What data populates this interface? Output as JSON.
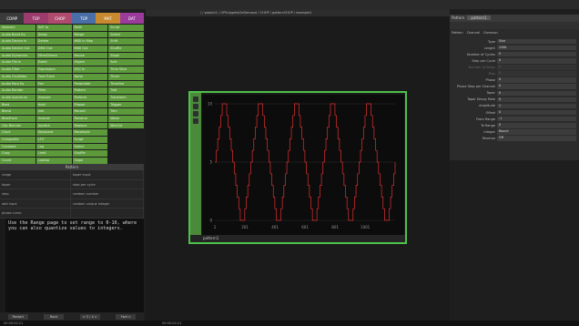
{
  "path": {
    "text": "/ / project1 / OPSnippetsOnDemand / CHOP / patternCHOP / example1"
  },
  "tabs": [
    {
      "label": "COMP",
      "color": "#3a3a3a"
    },
    {
      "label": "TOP",
      "color": "#9b3b6e"
    },
    {
      "label": "CHOP",
      "color": "#b04b6e"
    },
    {
      "label": "TOP",
      "color": "#4a6fa8"
    },
    {
      "label": "MAT",
      "color": "#c98a2f"
    },
    {
      "label": "DAT",
      "color": "#9b3b9b"
    }
  ],
  "operators": [
    "Abstract",
    "DAT to",
    "Math",
    "Script",
    "Audio Band Eq",
    "Delay",
    "Merge",
    "Select",
    "Audio Device In",
    "Delete",
    "MIDI In Map",
    "Shift",
    "Audio Device Out",
    "DMX Out",
    "MIDI Out",
    "Shuffle",
    "Audio Dynamics",
    "EtherDream",
    "Mouse",
    "Slope",
    "Audio File In",
    "Event",
    "Object",
    "Sort",
    "Audio Filter",
    "Expression",
    "OSC In",
    "Time Slice",
    "Audio Oscillator",
    "Face Track",
    "Noise",
    "Timer",
    "Audio Para Eq",
    "Fan",
    "Parameter",
    "Timeline",
    "Audio Render",
    "Filter",
    "Pattern",
    "Trail",
    "Audio Spectrum",
    "Gesture",
    "Perform",
    "Transform",
    "Beat",
    "Hold",
    "Phaser",
    "Trigger",
    "Blend",
    "Info",
    "Record",
    "Trim",
    "BlobTrack",
    "Inverse",
    "Rename",
    "Wave",
    "Clip Blender",
    "Joystick",
    "Replace",
    "WrnOut",
    "Clock",
    "Keyboard",
    "Resample",
    "",
    "Composite",
    "LFO",
    "Script",
    "",
    "Constant",
    "Lag",
    "Select",
    "",
    "Copy",
    "Limit",
    "Shuffle",
    "",
    "Count",
    "Lookup",
    "Slope",
    ""
  ],
  "info": {
    "title": "Pattern",
    "rows": [
      "range",
      "taper input",
      "taper",
      "step per cycle",
      "step",
      "random number",
      "add input",
      "random unique integer",
      "phase curve",
      ""
    ]
  },
  "textbox": {
    "content": "Use the Range page to set range to 0-10, where you can also quantize values to integers."
  },
  "nav": {
    "first": "Restart",
    "prev": "Back",
    "next": "< 3 / 4 >",
    "last": "Fwd >"
  },
  "bottom": {
    "left_time": "00:00:02:21",
    "right_time": "00:00:02:21"
  },
  "node": {
    "name": "pattern1"
  },
  "chart_data": {
    "type": "line",
    "x": [
      1,
      10,
      20,
      30,
      40,
      50,
      60,
      70,
      80,
      90,
      100,
      110,
      120,
      130,
      140,
      150,
      160,
      170,
      180,
      190,
      200,
      210,
      220,
      230,
      240,
      250,
      260,
      270,
      280,
      290,
      300,
      310,
      320,
      330,
      340,
      350,
      360,
      370,
      380,
      390,
      400,
      410,
      420,
      430,
      440,
      450,
      460,
      470,
      480,
      490,
      500,
      510,
      520,
      530,
      540,
      550,
      560,
      570,
      580,
      590,
      600,
      610,
      620,
      630,
      640,
      650,
      660,
      670,
      680,
      690,
      700,
      710,
      720,
      730,
      740,
      750,
      760,
      770,
      780,
      790,
      800,
      810,
      820,
      830,
      840,
      850,
      860,
      870,
      880,
      890,
      900,
      910,
      920,
      930,
      940,
      950,
      960,
      970,
      980,
      990,
      1000,
      1010,
      1020,
      1030,
      1040,
      1050,
      1060,
      1070,
      1080,
      1090,
      1100,
      1110,
      1120,
      1130,
      1140,
      1150,
      1160,
      1170,
      1180,
      1190,
      1200
    ],
    "y": [
      5,
      6,
      7,
      8,
      9,
      10,
      10,
      10,
      9,
      8,
      7,
      6,
      5,
      4,
      3,
      2,
      1,
      0,
      0,
      0,
      1,
      2,
      3,
      4,
      5,
      6,
      7,
      8,
      9,
      10,
      10,
      10,
      9,
      8,
      7,
      6,
      5,
      4,
      3,
      2,
      1,
      0,
      0,
      0,
      1,
      2,
      3,
      4,
      5,
      6,
      7,
      8,
      9,
      10,
      10,
      10,
      9,
      8,
      7,
      6,
      5,
      4,
      3,
      2,
      1,
      0,
      0,
      0,
      1,
      2,
      3,
      4,
      5,
      6,
      7,
      8,
      9,
      10,
      10,
      10,
      9,
      8,
      7,
      6,
      5,
      4,
      3,
      2,
      1,
      0,
      0,
      0,
      1,
      2,
      3,
      4,
      5,
      6,
      7,
      8,
      9,
      10,
      10,
      10,
      9,
      8,
      7,
      6,
      5,
      4,
      3,
      2,
      1,
      0,
      0,
      0,
      1,
      2,
      3,
      4,
      5
    ],
    "xticks": [
      "1",
      "201",
      "401",
      "601",
      "801",
      "1001"
    ],
    "yticks": [
      "10",
      "5",
      "0"
    ],
    "xlim": [
      1,
      1200
    ],
    "ylim": [
      0,
      10
    ],
    "series_color": "#e03030",
    "grid": true
  },
  "params": {
    "title": "Pattern",
    "name": "pattern1",
    "tabs": [
      "Pattern",
      "Channel",
      "Common"
    ],
    "rows": [
      {
        "label": "Type",
        "value": "Sine",
        "dim": false
      },
      {
        "label": "Length",
        "value": "1200",
        "dim": false
      },
      {
        "label": "Number of Cycles",
        "value": "5",
        "dim": false
      },
      {
        "label": "Step per Cycle",
        "value": "0",
        "dim": false
      },
      {
        "label": "Number of Steps",
        "value": "0",
        "dim": true
      },
      {
        "label": "Bias",
        "value": "0",
        "dim": true
      },
      {
        "label": "Phase",
        "value": "0",
        "dim": false
      },
      {
        "label": "Phase Step per Channel",
        "value": "0",
        "dim": false
      },
      {
        "label": "Taper",
        "value": "0",
        "dim": false
      },
      {
        "label": "Taper Decay Rate",
        "value": "0",
        "dim": false
      },
      {
        "label": "Amplitude",
        "value": "1",
        "dim": false
      },
      {
        "label": "Offset",
        "value": "0",
        "dim": false
      },
      {
        "label": "From Range",
        "value": "-1",
        "dim": false
      },
      {
        "label": "To Range",
        "value": "0",
        "dim": false
      },
      {
        "label": "Integer",
        "value": "Round",
        "dim": false
      },
      {
        "label": "Reverse",
        "value": "Off",
        "dim": false
      }
    ]
  }
}
